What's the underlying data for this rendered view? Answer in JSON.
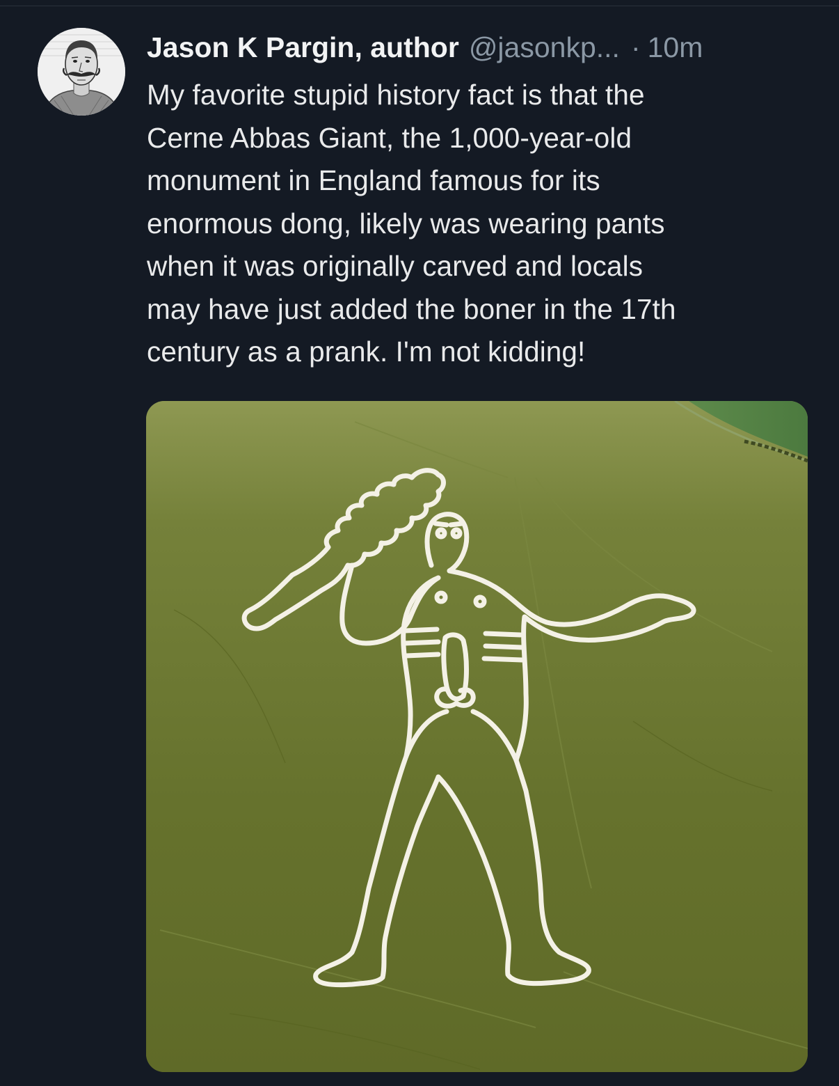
{
  "tweet": {
    "display_name": "Jason K Pargin, author",
    "handle": "@jasonkp...",
    "separator": "·",
    "timestamp": "10m",
    "text": "My favorite stupid history fact is that the\nCerne Abbas Giant, the 1,000-year-old\nmonument in England famous for its\nenormous dong, likely was wearing pants\nwhen it was originally carved and locals\nmay have just added the boner in the 17th\ncentury as a prank. I'm not kidding!",
    "media": {
      "icon": "photo-hill-figure"
    }
  },
  "colors": {
    "background": "#141a24",
    "text": "#e9eaeb",
    "secondary_text": "#8b98a5",
    "grass": "#6a7630",
    "chalk": "#f4f1e6"
  }
}
